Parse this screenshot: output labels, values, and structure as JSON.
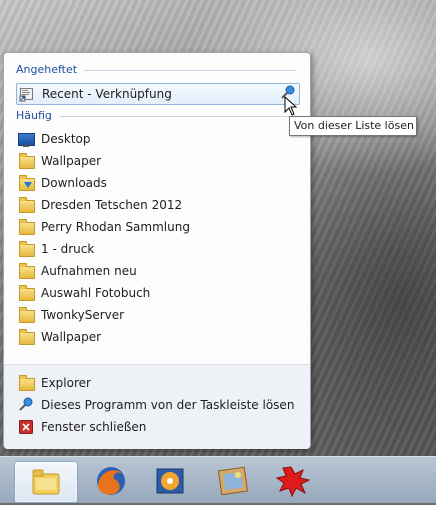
{
  "jumplist": {
    "pinned_header": "Angeheftet",
    "pinned_item": "Recent - Verknüpfung",
    "frequent_header": "Häufig",
    "frequent_items": [
      "Desktop",
      "Wallpaper",
      "Downloads",
      "Dresden Tetschen 2012",
      "Perry Rhodan Sammlung",
      "1 - druck",
      "Aufnahmen neu",
      "Auswahl Fotobuch",
      "TwonkyServer",
      "Wallpaper"
    ],
    "tasks": [
      "Explorer",
      "Dieses Programm von der Taskleiste lösen",
      "Fenster schließen"
    ]
  },
  "tooltip": "Von dieser Liste lösen",
  "taskbar": {
    "buttons": [
      "explorer",
      "firefox",
      "media-player",
      "photo-viewer",
      "red-splat-app"
    ]
  },
  "colors": {
    "header_text": "#1e50a0",
    "pinned_highlight": "#e4effb",
    "close_icon": "#c8302a"
  }
}
